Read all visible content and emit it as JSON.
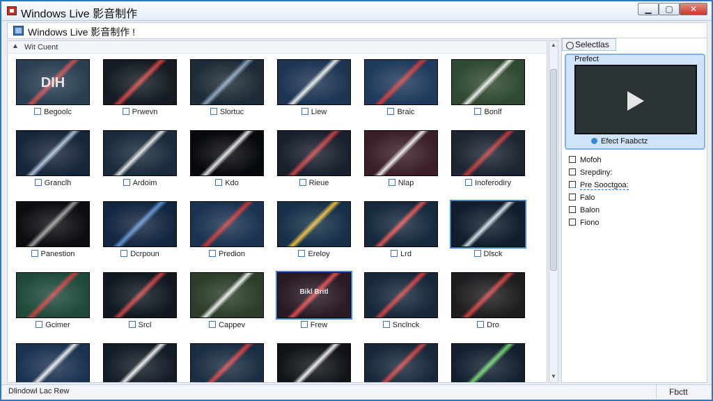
{
  "window": {
    "title": "Windows Live 影音制作",
    "controls": {
      "min": "▁",
      "max": "▢",
      "close": "✕"
    }
  },
  "toolbar": {
    "title": "Windows Live 影音制作 !"
  },
  "gallery": {
    "header_label": "Wit Cuent",
    "header_arrow": "▲",
    "items": [
      {
        "label": "Begoolc",
        "thumb_colors": [
          "#2a3f52",
          "#c45050"
        ],
        "selected": false
      },
      {
        "label": "Prwevn",
        "thumb_colors": [
          "#141b22",
          "#d04040"
        ],
        "selected": false
      },
      {
        "label": "Slortuc",
        "thumb_colors": [
          "#1d2b38",
          "#8aa2bd"
        ],
        "selected": false
      },
      {
        "label": "Liew",
        "thumb_colors": [
          "#1c3552",
          "#e8e8e8"
        ],
        "selected": false
      },
      {
        "label": "Braic",
        "thumb_colors": [
          "#1f3a5c",
          "#d03a3a"
        ],
        "selected": false
      },
      {
        "label": "Bonlf",
        "thumb_colors": [
          "#2f4a30",
          "#e8e8e8"
        ],
        "selected": false
      },
      {
        "label": "Granclh",
        "thumb_colors": [
          "#17263a",
          "#a9c0d8"
        ],
        "selected": false
      },
      {
        "label": "Ardoim",
        "thumb_colors": [
          "#1a2b3b",
          "#e0e0e0"
        ],
        "selected": false
      },
      {
        "label": "Kdo",
        "thumb_colors": [
          "#06090d",
          "#e0e0e0"
        ],
        "selected": false
      },
      {
        "label": "Rieue",
        "thumb_colors": [
          "#1a1f2e",
          "#c84040"
        ],
        "selected": false
      },
      {
        "label": "Nlap",
        "thumb_colors": [
          "#3a2026",
          "#e8e8e8"
        ],
        "selected": false
      },
      {
        "label": "Inoferodiry",
        "thumb_colors": [
          "#1d2432",
          "#c03a3a"
        ],
        "selected": false
      },
      {
        "label": "Panestion",
        "thumb_colors": [
          "#0b0d10",
          "#9a9a9a"
        ],
        "selected": false
      },
      {
        "label": "Dcrpoun",
        "thumb_colors": [
          "#132640",
          "#5e8fd0"
        ],
        "selected": false
      },
      {
        "label": "Predion",
        "thumb_colors": [
          "#1a3350",
          "#c83838"
        ],
        "selected": false
      },
      {
        "label": "Ereloy",
        "thumb_colors": [
          "#153048",
          "#e8b83a"
        ],
        "selected": false
      },
      {
        "label": "Lrd",
        "thumb_colors": [
          "#16293d",
          "#e05050"
        ],
        "selected": false
      },
      {
        "label": "Dlsck",
        "thumb_colors": [
          "#0f1d2c",
          "#cfd8e2"
        ],
        "selected": true
      },
      {
        "label": "Gcimer",
        "thumb_colors": [
          "#1f4a3a",
          "#c84040"
        ],
        "selected": false
      },
      {
        "label": "Srcl",
        "thumb_colors": [
          "#111820",
          "#c84040"
        ],
        "selected": false
      },
      {
        "label": "Cappev",
        "thumb_colors": [
          "#2c3d2a",
          "#e8e8e8"
        ],
        "selected": false
      },
      {
        "label": "Frew",
        "thumb_colors": [
          "#2a1a26",
          "#e04a4a"
        ],
        "selected": true
      },
      {
        "label": "Snclnck",
        "thumb_colors": [
          "#16283a",
          "#d04040"
        ],
        "selected": false
      },
      {
        "label": "Dro",
        "thumb_colors": [
          "#1f1d20",
          "#d04040"
        ],
        "selected": false
      },
      {
        "label": "",
        "thumb_colors": [
          "#1a3350",
          "#e8e8e8"
        ],
        "selected": false
      },
      {
        "label": "",
        "thumb_colors": [
          "#141c26",
          "#e8e8e8"
        ],
        "selected": false
      },
      {
        "label": "",
        "thumb_colors": [
          "#1a2d42",
          "#d04040"
        ],
        "selected": false
      },
      {
        "label": "",
        "thumb_colors": [
          "#101418",
          "#e8e8e8"
        ],
        "selected": false
      },
      {
        "label": "",
        "thumb_colors": [
          "#17283a",
          "#d04040"
        ],
        "selected": false
      },
      {
        "label": "",
        "thumb_colors": [
          "#122030",
          "#6bd06b"
        ],
        "selected": false
      }
    ],
    "thumb_overlays": [
      "DIH",
      "",
      "",
      "",
      "",
      "",
      "",
      "",
      "",
      "",
      "",
      "",
      "",
      "",
      "",
      "",
      "",
      "",
      "",
      "",
      "",
      "Bikl Britl",
      "",
      "",
      "",
      "",
      "",
      "",
      "",
      ""
    ]
  },
  "panel": {
    "tab_label": "Selectlas",
    "preview_label": "Prefect",
    "preview_footer": "Efect Faabctz",
    "properties": [
      {
        "label": "Mofoh",
        "wavy": false
      },
      {
        "label": "Srepdiny:",
        "wavy": false
      },
      {
        "label": "Pre Sooctgoa:",
        "wavy": true
      },
      {
        "label": "Falo",
        "wavy": false
      },
      {
        "label": "Balon",
        "wavy": false
      },
      {
        "label": "Fiono",
        "wavy": false
      }
    ]
  },
  "statusbar": {
    "left": "Dlindowl Lac Rew",
    "right": "Fbctt"
  },
  "colors": {
    "accent": "#3a86d6",
    "frame": "#2a78c2"
  }
}
